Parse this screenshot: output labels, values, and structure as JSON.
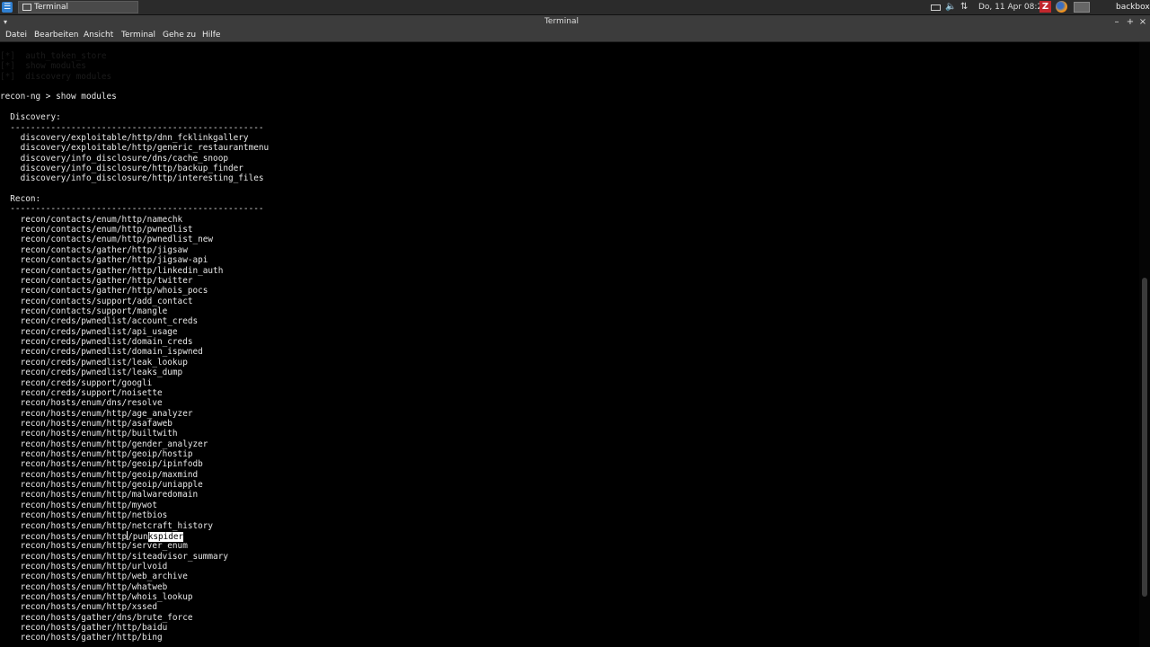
{
  "panel": {
    "start_icon": "app-menu-icon",
    "task_label": "Terminal",
    "clock": "Do, 11 Apr 08:24",
    "hostname": "backbox",
    "tray_icons": [
      "mail-icon",
      "volume-icon",
      "network-icon",
      "filezilla-icon",
      "firefox-icon",
      "workspace-icon"
    ]
  },
  "window": {
    "title": "Terminal"
  },
  "menubar": {
    "items": [
      "Datei",
      "Bearbeiten",
      "Ansicht",
      "Terminal",
      "Gehe zu",
      "Hilfe"
    ]
  },
  "terminal": {
    "faded_lines": [
      "[*]  auth_token_store",
      "[*]  show modules",
      "[*]  discovery modules"
    ],
    "prompt": "recon-ng > show modules",
    "sections": [
      {
        "header": "  Discovery:",
        "rule": "  --------------------------------------------------",
        "modules": [
          "    discovery/exploitable/http/dnn_fcklinkgallery",
          "    discovery/exploitable/http/generic_restaurantmenu",
          "    discovery/info_disclosure/dns/cache_snoop",
          "    discovery/info_disclosure/http/backup_finder",
          "    discovery/info_disclosure/http/interesting_files"
        ]
      },
      {
        "header": "  Recon:",
        "rule": "  --------------------------------------------------",
        "modules": [
          "    recon/contacts/enum/http/namechk",
          "    recon/contacts/enum/http/pwnedlist",
          "    recon/contacts/enum/http/pwnedlist_new",
          "    recon/contacts/gather/http/jigsaw",
          "    recon/contacts/gather/http/jigsaw-api",
          "    recon/contacts/gather/http/linkedin_auth",
          "    recon/contacts/gather/http/twitter",
          "    recon/contacts/gather/http/whois_pocs",
          "    recon/contacts/support/add_contact",
          "    recon/contacts/support/mangle",
          "    recon/creds/pwnedlist/account_creds",
          "    recon/creds/pwnedlist/api_usage",
          "    recon/creds/pwnedlist/domain_creds",
          "    recon/creds/pwnedlist/domain_ispwned",
          "    recon/creds/pwnedlist/leak_lookup",
          "    recon/creds/pwnedlist/leaks_dump",
          "    recon/creds/support/googli",
          "    recon/creds/support/noisette",
          "    recon/hosts/enum/dns/resolve",
          "    recon/hosts/enum/http/age_analyzer",
          "    recon/hosts/enum/http/asafaweb",
          "    recon/hosts/enum/http/builtwith",
          "    recon/hosts/enum/http/gender_analyzer",
          "    recon/hosts/enum/http/geoip/hostip",
          "    recon/hosts/enum/http/geoip/ipinfodb",
          "    recon/hosts/enum/http/geoip/maxmind",
          "    recon/hosts/enum/http/geoip/uniapple",
          "    recon/hosts/enum/http/malwaredomain",
          "    recon/hosts/enum/http/mywot",
          "    recon/hosts/enum/http/netbios",
          "    recon/hosts/enum/http/netcraft_history",
          "    recon/hosts/enum/http/punkspider",
          "    recon/hosts/enum/http/server_enum",
          "    recon/hosts/enum/http/siteadvisor_summary",
          "    recon/hosts/enum/http/urlvoid",
          "    recon/hosts/enum/http/web_archive",
          "    recon/hosts/enum/http/whatweb",
          "    recon/hosts/enum/http/whois_lookup",
          "    recon/hosts/enum/http/xssed",
          "    recon/hosts/gather/dns/brute_force",
          "    recon/hosts/gather/http/baidu",
          "    recon/hosts/gather/http/bing"
        ]
      }
    ],
    "selected_text": "kspider"
  }
}
